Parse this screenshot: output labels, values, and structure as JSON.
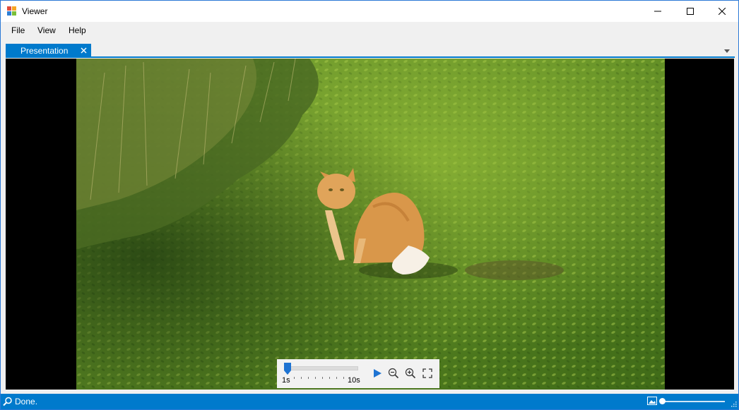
{
  "window": {
    "title": "Viewer"
  },
  "menu": {
    "items": [
      "File",
      "View",
      "Help"
    ]
  },
  "tabs": [
    {
      "label": "Presentation"
    }
  ],
  "player": {
    "min_label": "1s",
    "max_label": "10s",
    "position": 0.0
  },
  "status": {
    "text": "Done.",
    "zoom_level": 0.0
  },
  "colors": {
    "accent": "#007acc",
    "window_border": "#2b79d6",
    "play": "#1e73d2"
  },
  "icons": {
    "app": "app-grid-icon",
    "status": "search-icon",
    "zoom": "image-icon",
    "play": "play-icon",
    "zoom_out": "zoom-out-icon",
    "zoom_in": "zoom-in-icon",
    "fullscreen": "fullscreen-icon"
  }
}
